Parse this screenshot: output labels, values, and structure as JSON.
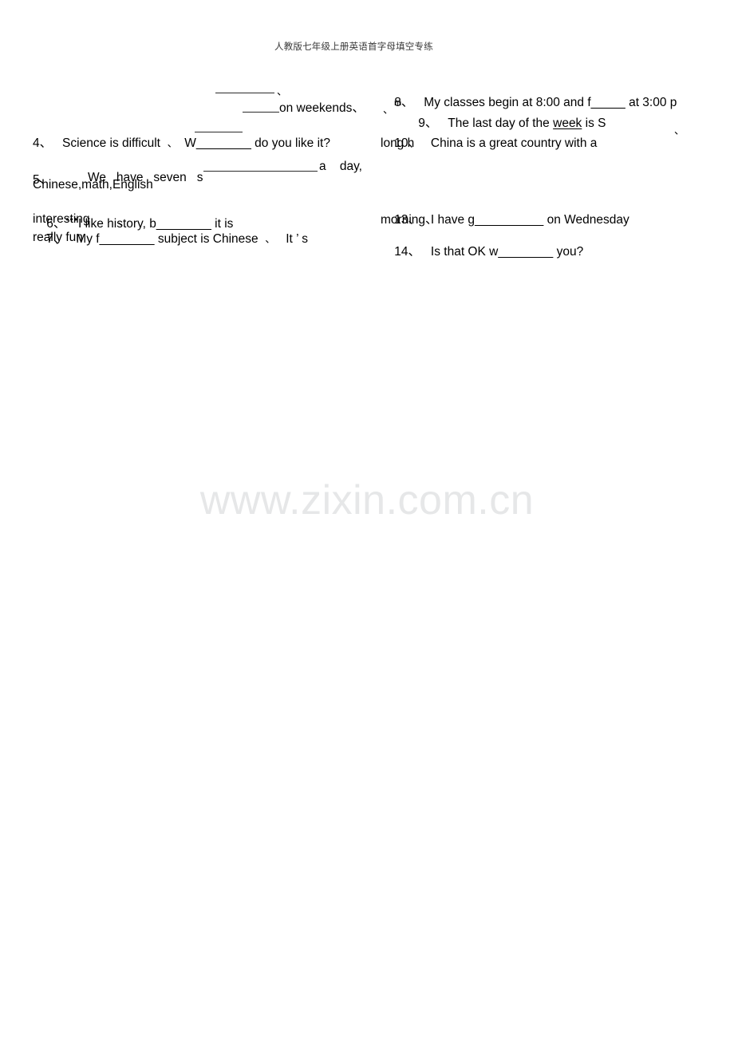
{
  "document": {
    "header_title": "人教版七年级上册英语首字母填空专练",
    "watermark": "www.zixin.com.cn",
    "background_color": "#ffffff",
    "text_color": "#000000",
    "watermark_color": "#e6e7e8"
  },
  "fragments": {
    "frag_punct_1": "、",
    "frag_on_weekends": "on weekends、",
    "frag_a_day": "a    day,",
    "frag_seven_s": "seven    s",
    "frag_chinese_math_english": "Chinese,math,English",
    "frag_interesting": "interesting",
    "frag_really_fun": "really fun",
    "frag_like_it": "like it?",
    "frag_long_h": "long h",
    "frag_morning": "morning、",
    "frag_punct_left_edge": "、",
    "frag_punct_mid": "、",
    "frag_m_superscript": "m",
    "frag_punct_right": "、",
    "frag_punct_item7": "、"
  },
  "left_column": {
    "items": [
      {
        "number": "4、",
        "text_before": "Science is difficult",
        "punct": "、",
        "prompt_letter": "W",
        "blank": "________",
        "text_after": "do you like it?"
      },
      {
        "number": "5、",
        "text": "We   have   seven   s",
        "continuation": "Chinese,math,English"
      },
      {
        "number": "6、",
        "sup_marks": "•••",
        "text_before": "I like history, b",
        "blank": "________",
        "text_after": "it is interesting"
      },
      {
        "number": "7、",
        "text_before": "My f",
        "blank": "________",
        "text_after": "subject is Chinese",
        "punct": "、",
        "tail": "It ’ s really fun"
      }
    ]
  },
  "right_column": {
    "items": [
      {
        "number": "8、",
        "text_before": "My classes begin at 8:00 and f",
        "blank": "_____",
        "text_after": "at 3:00 p",
        "tail": "m"
      },
      {
        "number": "9、",
        "text_before": "The last day of the",
        "underlined_word": "week",
        "text_after": "is S"
      },
      {
        "number": "10、",
        "text": "China is a great country with a long h"
      },
      {
        "number": "13、",
        "text_before": "I have g",
        "blank": "__________",
        "text_after": "on Wednesday morning、"
      },
      {
        "number": "14、",
        "text_before": "Is that OK w",
        "blank": "________",
        "text_after": "you?"
      }
    ]
  }
}
